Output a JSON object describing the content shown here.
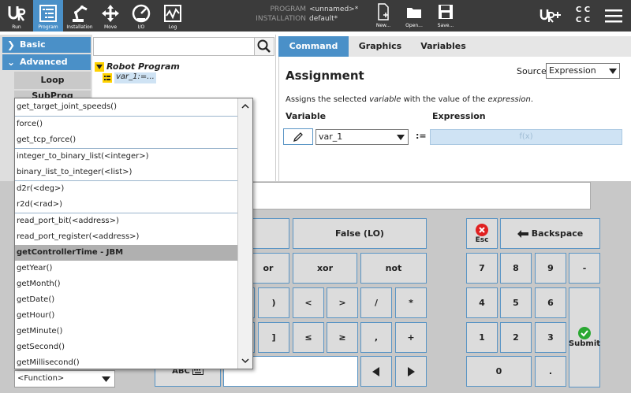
{
  "toolbar": {
    "buttons": [
      {
        "label": "Run"
      },
      {
        "label": "Program"
      },
      {
        "label": "Installation"
      },
      {
        "label": "Move"
      },
      {
        "label": "I/O"
      },
      {
        "label": "Log"
      }
    ],
    "program_key": "PROGRAM",
    "program_value": "<unnamed>*",
    "installation_key": "INSTALLATION",
    "installation_value": "default*",
    "file_buttons": [
      {
        "label": "New..."
      },
      {
        "label": "Open..."
      },
      {
        "label": "Save..."
      }
    ],
    "cc_label": "C C\nC C"
  },
  "left_panel": {
    "basic": "Basic",
    "advanced": "Advanced",
    "items": [
      "Loop",
      "SubProg"
    ]
  },
  "tree": {
    "root": "Robot Program",
    "child": "var_1:=..."
  },
  "command": {
    "tabs": [
      "Command",
      "Graphics",
      "Variables"
    ],
    "title": "Assignment",
    "source_label": "Source",
    "source_value": "Expression",
    "desc_pre": "Assigns the selected ",
    "desc_var": "variable",
    "desc_mid": " with the value of the ",
    "desc_expr": "expression",
    "desc_end": ".",
    "variable_label": "Variable",
    "expression_label": "Expression",
    "variable_value": "var_1",
    "assign_op": ":=",
    "expression_placeholder": "f(x)"
  },
  "popup": {
    "items": [
      {
        "text": "get_target_joint_speeds()"
      },
      {
        "text": "force()"
      },
      {
        "text": "get_tcp_force()"
      },
      {
        "text": "integer_to_binary_list(<integer>)"
      },
      {
        "text": "binary_list_to_integer(<list>)"
      },
      {
        "text": "d2r(<deg>)"
      },
      {
        "text": "r2d(<rad>)"
      },
      {
        "text": "read_port_bit(<address>)"
      },
      {
        "text": "read_port_register(<address>)"
      },
      {
        "text": "getControllerTime - JBM"
      },
      {
        "text": "getYear()"
      },
      {
        "text": "getMonth()"
      },
      {
        "text": "getDate()"
      },
      {
        "text": "getHour()"
      },
      {
        "text": "getMinute()"
      },
      {
        "text": "getSecond()"
      },
      {
        "text": "getMillisecond()"
      }
    ]
  },
  "function_select": "<Function>",
  "keypad": {
    "false_lo": "False (LO)",
    "or": "or",
    "xor": "xor",
    "not": "not",
    "rparen": ")",
    "lt": "<",
    "gt": ">",
    "div": "/",
    "mul": "*",
    "rbracket": "]",
    "le": "≤",
    "ge": "≥",
    "comma": ",",
    "plus": "+",
    "abc": "ABC",
    "esc": "Esc",
    "backspace": "Backspace",
    "minus": "-",
    "submit": "Submit",
    "dot": ".",
    "digits": [
      "7",
      "8",
      "9",
      "4",
      "5",
      "6",
      "1",
      "2",
      "3",
      "0"
    ]
  }
}
